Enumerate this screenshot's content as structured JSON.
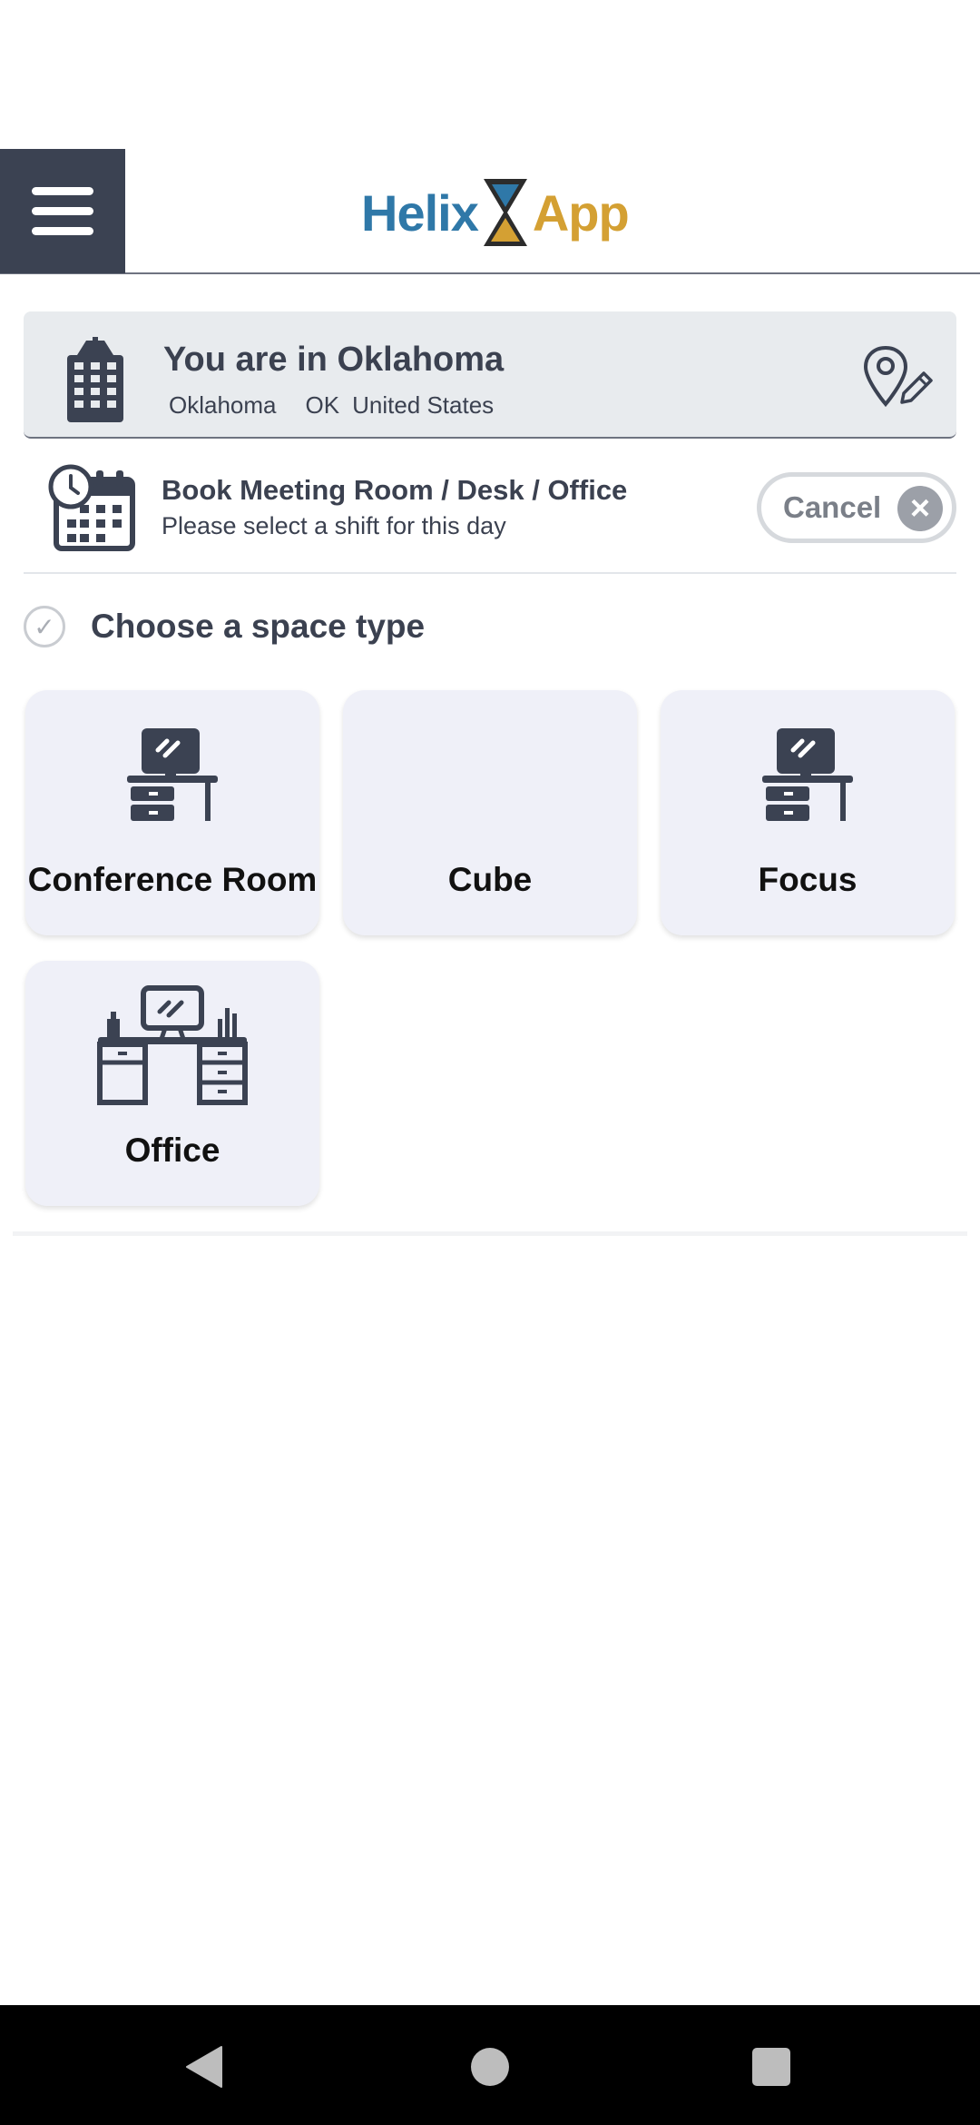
{
  "header": {
    "menu_icon": "hamburger-menu-icon",
    "logo_left": "Helix",
    "logo_right": "App",
    "colors": {
      "brand_blue": "#2f78a8",
      "brand_gold": "#d4a033",
      "menu_bg": "#3b4252"
    }
  },
  "location": {
    "title": "You are in Oklahoma",
    "city": "Oklahoma",
    "state": "OK",
    "country": "United States",
    "icon": "building-icon",
    "edit_icon": "location-edit-icon"
  },
  "booking": {
    "title": "Book Meeting Room / Desk / Office",
    "subtitle": "Please select a shift for this day",
    "icon": "calendar-clock-icon",
    "cancel_label": "Cancel",
    "cancel_icon": "close-circle-icon"
  },
  "space_type": {
    "heading": "Choose a space type",
    "options": [
      {
        "label": "Conference Room",
        "icon": "desk-monitor-icon"
      },
      {
        "label": "Cube",
        "icon": ""
      },
      {
        "label": "Focus",
        "icon": "desk-monitor-icon"
      },
      {
        "label": "Office",
        "icon": "office-desk-icon"
      }
    ]
  },
  "navbar": {
    "back_icon": "back-triangle-icon",
    "home_icon": "home-circle-icon",
    "recent_icon": "recent-square-icon"
  }
}
